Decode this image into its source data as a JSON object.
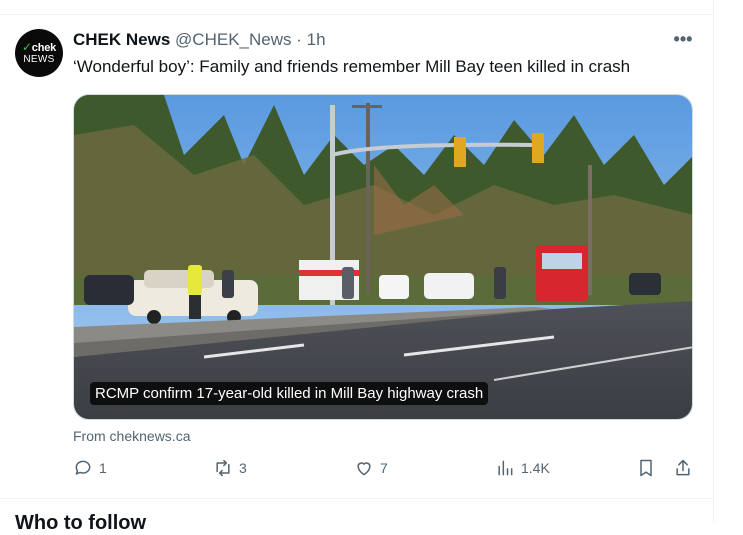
{
  "tweet": {
    "display_name": "CHEK News",
    "handle": "@CHEK_News",
    "separator": "·",
    "time": "1h",
    "text": "‘Wonderful boy’: Family and friends remember Mill Bay teen killed in crash",
    "avatar": {
      "line1": "chek",
      "line2": "NEWS",
      "check": "✓"
    },
    "more_label": "•••",
    "media": {
      "caption": "RCMP confirm 17-year-old killed in Mill Bay highway crash"
    },
    "source": "From cheknews.ca",
    "actions": {
      "replies": "1",
      "reposts": "3",
      "likes": "7",
      "views": "1.4K"
    }
  },
  "next_section": {
    "title": "Who to follow"
  },
  "colors": {
    "text": "#0f1419",
    "muted": "#536471",
    "border": "#eff3f4"
  }
}
